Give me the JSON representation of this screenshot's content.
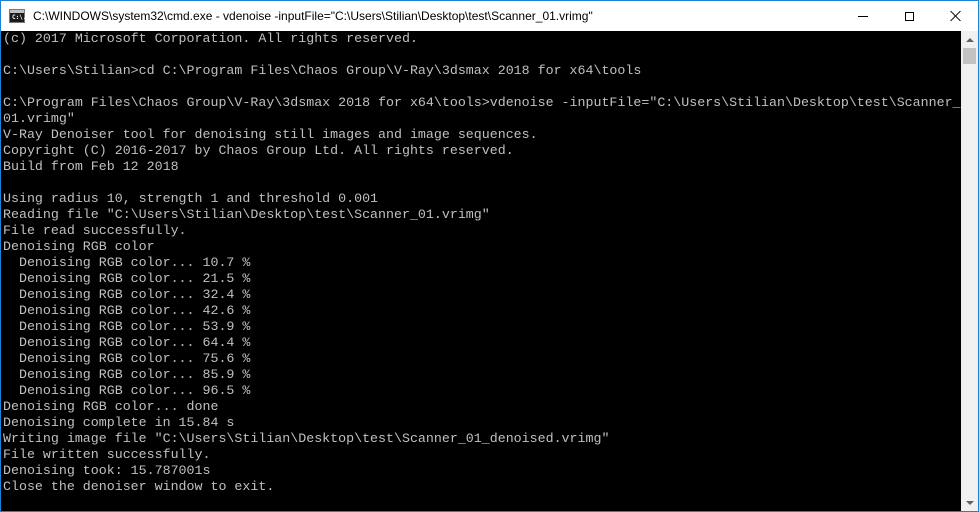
{
  "window": {
    "title": "C:\\WINDOWS\\system32\\cmd.exe - vdenoise  -inputFile=\"C:\\Users\\Stilian\\Desktop\\test\\Scanner_01.vrimg\"",
    "icon_glyph": "C:\\.",
    "icon": "cmd-icon",
    "controls": {
      "minimize": "minimize-icon",
      "maximize": "maximize-icon",
      "close": "close-icon"
    }
  },
  "console": {
    "background": "#000000",
    "foreground": "#c0c0c0",
    "lines": [
      "(c) 2017 Microsoft Corporation. All rights reserved.",
      "",
      "C:\\Users\\Stilian>cd C:\\Program Files\\Chaos Group\\V-Ray\\3dsmax 2018 for x64\\tools",
      "",
      "C:\\Program Files\\Chaos Group\\V-Ray\\3dsmax 2018 for x64\\tools>vdenoise -inputFile=\"C:\\Users\\Stilian\\Desktop\\test\\Scanner_",
      "01.vrimg\"",
      "V-Ray Denoiser tool for denoising still images and image sequences.",
      "Copyright (C) 2016-2017 by Chaos Group Ltd. All rights reserved.",
      "Build from Feb 12 2018",
      "",
      "Using radius 10, strength 1 and threshold 0.001",
      "Reading file \"C:\\Users\\Stilian\\Desktop\\test\\Scanner_01.vrimg\"",
      "File read successfully.",
      "Denoising RGB color",
      "  Denoising RGB color... 10.7 %",
      "  Denoising RGB color... 21.5 %",
      "  Denoising RGB color... 32.4 %",
      "  Denoising RGB color... 42.6 %",
      "  Denoising RGB color... 53.9 %",
      "  Denoising RGB color... 64.4 %",
      "  Denoising RGB color... 75.6 %",
      "  Denoising RGB color... 85.9 %",
      "  Denoising RGB color... 96.5 %",
      "Denoising RGB color... done",
      "Denoising complete in 15.84 s",
      "Writing image file \"C:\\Users\\Stilian\\Desktop\\test\\Scanner_01_denoised.vrimg\"",
      "File written successfully.",
      "Denoising took: 15.787001s",
      "Close the denoiser window to exit."
    ]
  },
  "scrollbar": {
    "up_icon": "scroll-up-arrow-icon",
    "down_icon": "scroll-down-arrow-icon"
  },
  "colors": {
    "border": "#1883d7",
    "titlebar": "#ffffff",
    "scrollbar_track": "#f0f0f0",
    "scrollbar_thumb": "#c2c2c2"
  }
}
